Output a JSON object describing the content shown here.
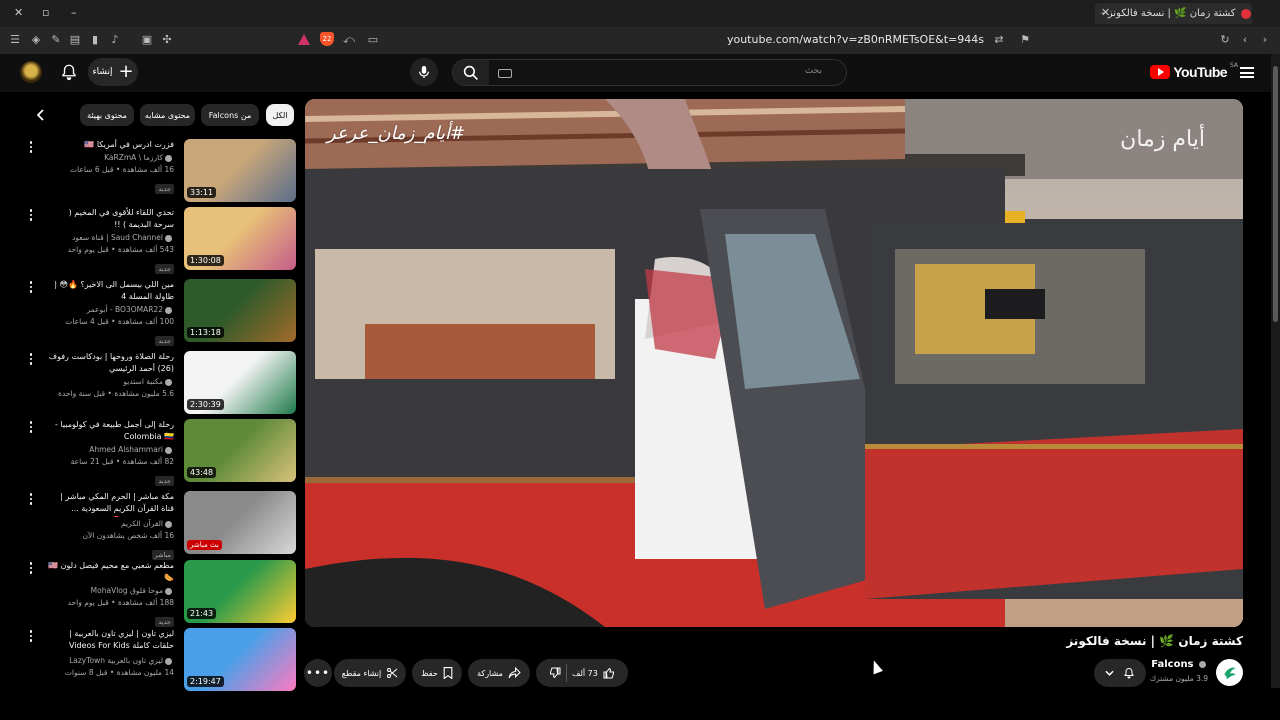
{
  "browser": {
    "tab_title": "كشتة زمان 🌿 | نسخة فالكونز -",
    "url": "youtube.com/watch?v=zB0nRMETsOE&t=944s",
    "brave_badge": "22"
  },
  "header": {
    "logo_text": "YouTube",
    "region": "SA",
    "search_placeholder": "بحث",
    "create_label": "إنشاء"
  },
  "player": {
    "watermark_left": "#أيام_زمان_عرعر",
    "watermark_right": "أيام زمان"
  },
  "chips": [
    {
      "label": "الكل"
    },
    {
      "label": "من Falcons"
    },
    {
      "label": "محتوى مشابه"
    },
    {
      "label": "محتوى بهيئة"
    }
  ],
  "related": [
    {
      "title": "فزرت ادرس في أمريكا 🇺🇸",
      "channel": "كارزما \\ KaRZmA",
      "views": "16 ألف مشاهدة",
      "age": "قبل 6 ساعات",
      "duration": "33:11",
      "badge": "جديد",
      "colors": [
        "#c9a77a",
        "#5b6e8a"
      ]
    },
    {
      "title": "تحدي اللقاء للأقوى في المخيم ( سرحة البديمة ) !!",
      "channel": "Saud Channel | قناة سعود",
      "views": "543 ألف مشاهدة",
      "age": "قبل يوم واحد",
      "duration": "1:30:08",
      "badge": "جديد",
      "colors": [
        "#e7c079",
        "#c55c89"
      ]
    },
    {
      "title": "مين اللي بيسمل الى الاخير؟ 🔥😳 | طاولة المسلة 4",
      "channel": "BO3OMAR22 - أبوعمر",
      "views": "100 ألف مشاهدة",
      "age": "قبل 4 ساعات",
      "duration": "1:13:18",
      "badge": "جديد",
      "colors": [
        "#2f5a2a",
        "#a36b2a"
      ]
    },
    {
      "title": "رحلة الصلاة وروحها | بودكاست رفوف (26) أحمد الرئيسي",
      "channel": "مكتبة استديو",
      "views": "5.6 مليون مشاهدة",
      "age": "قبل سنة واحدة",
      "duration": "2:30:39",
      "badge": "",
      "colors": [
        "#f4f4f4",
        "#1f7a4c"
      ]
    },
    {
      "title": "رحلة إلى أجمل طبيعة في كولومبيا - Colombia 🇨🇴",
      "channel": "Ahmed Alshammari",
      "views": "82 ألف مشاهدة",
      "age": "قبل 21 ساعة",
      "duration": "43:48",
      "badge": "جديد",
      "colors": [
        "#5f8a3a",
        "#d9c27a"
      ]
    },
    {
      "title": "مكة مباشر | الحرم المكي مباشر | قناة القرآن الكريم السعودية ... Makkah Live 🔴",
      "channel": "القرآن الكريم",
      "views": "16 ألف شخص يشاهدون الآن",
      "age": "",
      "duration": "",
      "live": "بث مباشر",
      "badge": "مباشر",
      "colors": [
        "#8a8a8a",
        "#d8d8d8"
      ]
    },
    {
      "title": "مطعم شعبي مع محيم فيصل دلون 🇺🇸🌭",
      "channel": "موحا فلوق MohaVlog",
      "views": "188 ألف مشاهدة",
      "age": "قبل يوم واحد",
      "duration": "21:43",
      "badge": "جديد",
      "colors": [
        "#2a9a4a",
        "#ffcc33"
      ]
    },
    {
      "title": "ليزي تاون | ليزي تاون بالعربية | حلقات كاملة Videos For Kids ساعتين",
      "channel": "ليزي تاون بالعربية LazyTown",
      "views": "14 مليون مشاهدة",
      "age": "قبل 8 سنوات",
      "duration": "2:19:47",
      "badge": "",
      "colors": [
        "#4aa0e8",
        "#ff7ac0"
      ]
    }
  ],
  "video": {
    "title": "كشتة زمان 🌿 | نسخة فالكونز",
    "channel": "Falcons",
    "subscribers": "3.9 مليون مشترك",
    "likes": "73 ألف",
    "share_label": "مشاركة",
    "save_label": "حفظ",
    "clip_label": "إنشاء مقطع"
  }
}
